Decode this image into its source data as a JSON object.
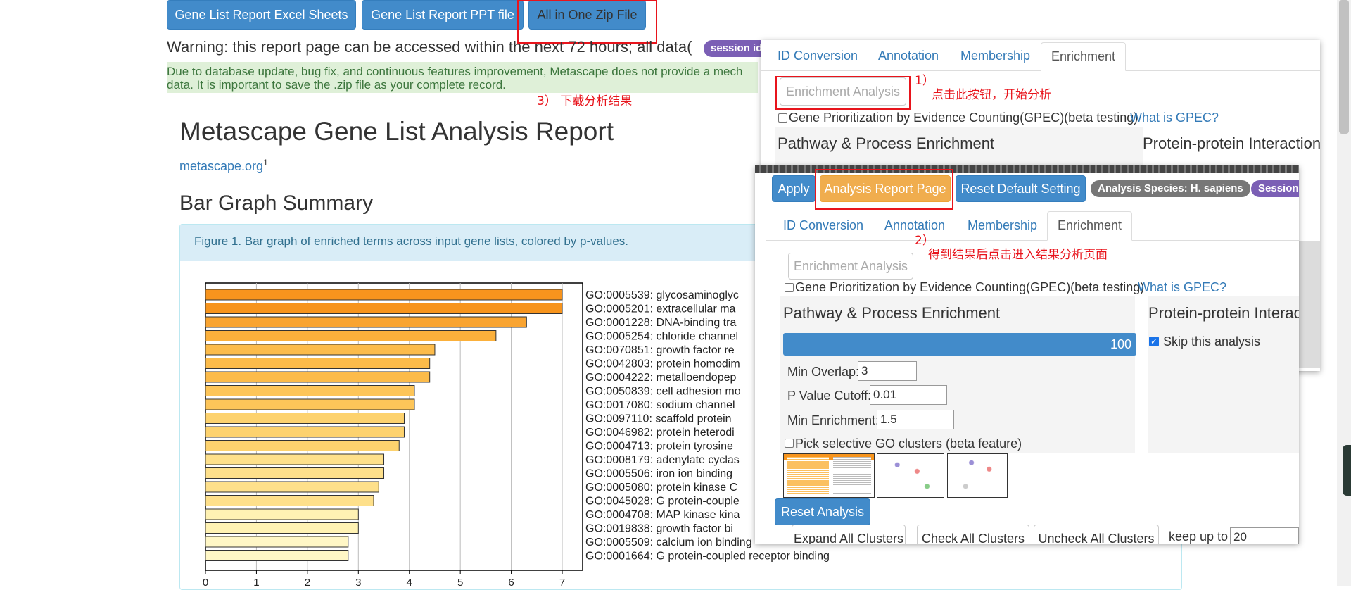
{
  "top_buttons": {
    "excel": "Gene List Report Excel Sheets",
    "ppt": "Gene List Report PPT file",
    "zip": "All in One Zip File"
  },
  "warning": "Warning: this report page can be accessed within the next 72 hours; all data(",
  "session_badge": "session id",
  "notice_line1": "Due to database update, bug fix, and continuous features improvement, Metascape does not provide a mech",
  "notice_line2": "data. It is important to save the .zip file as your complete record.",
  "annotation3": "3）   下载分析结果",
  "annotation1_num": "1）",
  "annotation1_text": "点击此按钮，开始分析",
  "annotation2_num": "2）",
  "annotation2_text": "得到结果后点击进入结果分析页面",
  "report_title": "Metascape Gene List Analysis Report",
  "report_link": "metascape.org",
  "report_link_sup": "1",
  "section_title": "Bar Graph Summary",
  "figure_caption": "Figure 1. Bar graph of enriched terms across input gene lists, colored by p-values.",
  "panel_back": {
    "tabs": [
      "ID Conversion",
      "Annotation",
      "Membership",
      "Enrichment"
    ],
    "enrich_button": "Enrichment Analysis",
    "gpec_label": "Gene Prioritization by Evidence Counting(GPEC)(beta testing)",
    "gpec_link": "What is GPEC?",
    "pathway_title": "Pathway & Process Enrichment",
    "ppi_title": "Protein-protein Interaction"
  },
  "panel_front": {
    "apply": "Apply",
    "report_page": "Analysis Report Page",
    "reset_default": "Reset Default Setting",
    "species_badge": "Analysis Species: H. sapiens",
    "session_badge": "Session",
    "tabs": [
      "ID Conversion",
      "Annotation",
      "Membership",
      "Enrichment"
    ],
    "enrich_button": "Enrichment Analysis",
    "gpec_label": "Gene Prioritization by Evidence Counting(GPEC)(beta testing)",
    "gpec_link": "What is GPEC?",
    "pathway_title": "Pathway & Process Enrichment",
    "ppi_title": "Protein-protein Interac",
    "progress_value": "100",
    "skip_label": "Skip this analysis",
    "min_overlap_label": "Min Overlap:",
    "min_overlap_value": "3",
    "pvalue_label": "P Value Cutoff:",
    "pvalue_value": "0.01",
    "min_enrich_label": "Min Enrichment:",
    "min_enrich_value": "1.5",
    "pick_label": "Pick selective GO clusters (beta feature)",
    "reset_analysis": "Reset Analysis",
    "expand_all": "Expand All Clusters",
    "check_all": "Check All Clusters",
    "uncheck_all": "Uncheck All Clusters",
    "keep_label": "keep up to",
    "keep_value": "20"
  },
  "chart_data": {
    "type": "bar",
    "orientation": "horizontal",
    "categories": [
      "GO:0005539: glycosaminoglyc",
      "GO:0005201: extracellular ma",
      "GO:0001228: DNA-binding tra",
      "GO:0005254: chloride channel",
      "GO:0070851: growth factor re",
      "GO:0042803: protein homodim",
      "GO:0004222: metalloendopep",
      "GO:0050839: cell adhesion mo",
      "GO:0017080: sodium channel",
      "GO:0097110: scaffold protein",
      "GO:0046982: protein heterodi",
      "GO:0004713: protein tyrosine",
      "GO:0008179: adenylate cyclas",
      "GO:0005506: iron ion binding",
      "GO:0005080: protein kinase C",
      "GO:0045028: G protein-couple",
      "GO:0004708: MAP kinase kina",
      "GO:0019838: growth factor bi",
      "GO:0005509: calcium ion binding",
      "GO:0001664: G protein-coupled receptor binding"
    ],
    "values": [
      7.0,
      7.0,
      6.3,
      5.7,
      4.5,
      4.4,
      4.4,
      4.1,
      4.1,
      3.9,
      3.9,
      3.8,
      3.5,
      3.5,
      3.4,
      3.3,
      3.0,
      3.0,
      2.8,
      2.8
    ],
    "colors": [
      "#f7941d",
      "#f7941d",
      "#f9a431",
      "#fbb03b",
      "#fcbb4a",
      "#fcbb4a",
      "#fcbb4a",
      "#fdc559",
      "#fdc559",
      "#fdd26e",
      "#fdd26e",
      "#fdd26e",
      "#fee08b",
      "#fee08b",
      "#fee08b",
      "#fee08b",
      "#fff2b3",
      "#fff2b3",
      "#fff7c6",
      "#fff7c6"
    ],
    "xlim": [
      0,
      7.4
    ],
    "xticks": [
      "0",
      "1",
      "2",
      "3",
      "4",
      "5",
      "6",
      "7"
    ],
    "grid": true
  }
}
